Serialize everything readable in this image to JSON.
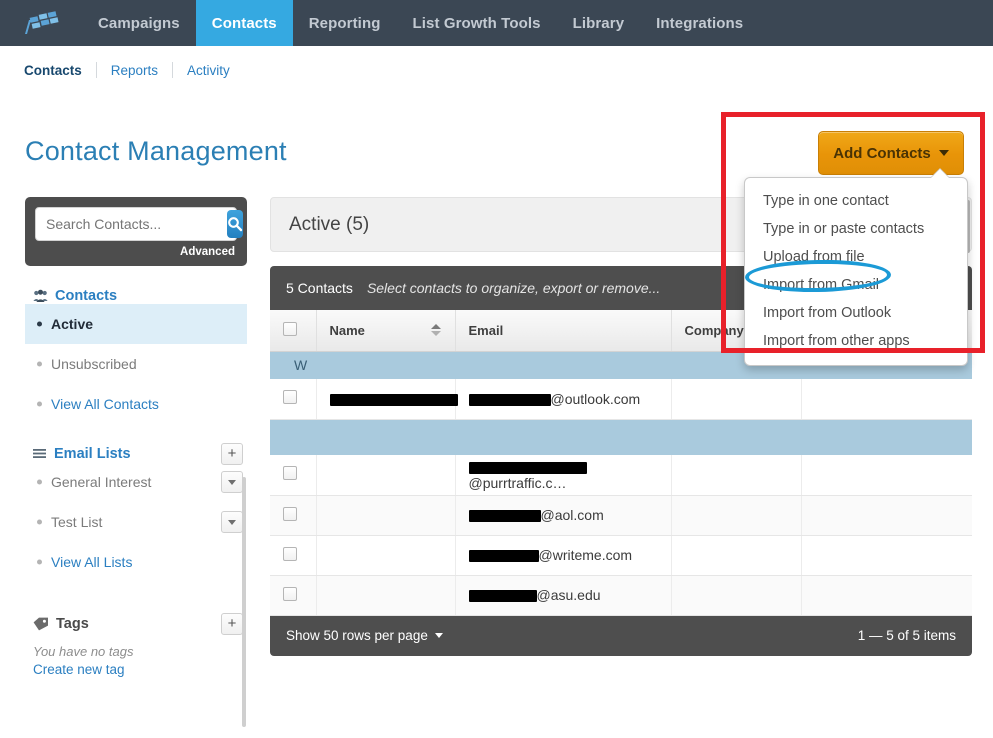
{
  "topnav": {
    "logo": "checkered-flag-logo",
    "items": [
      {
        "label": "Campaigns",
        "active": false
      },
      {
        "label": "Contacts",
        "active": true
      },
      {
        "label": "Reporting",
        "active": false
      },
      {
        "label": "List Growth Tools",
        "active": false
      },
      {
        "label": "Library",
        "active": false
      },
      {
        "label": "Integrations",
        "active": false
      }
    ],
    "active_color": "#35a9e1",
    "bg_color": "#3b4754"
  },
  "subnav": {
    "items": [
      {
        "label": "Contacts",
        "current": true
      },
      {
        "label": "Reports",
        "current": false
      },
      {
        "label": "Activity",
        "current": false
      }
    ]
  },
  "page": {
    "title": "Contact Management",
    "title_color": "#2b7fb4"
  },
  "add_contacts": {
    "label": "Add Contacts",
    "button_color": "#e89408",
    "menu": [
      "Type in one contact",
      "Type in or paste contacts",
      "Upload from file",
      "Import from Gmail",
      "Import from Outlook",
      "Import from other apps"
    ],
    "highlighted_item": "Import from Gmail"
  },
  "annotations": {
    "rectangle_color": "#e8212a",
    "ellipse_color": "#1b9ad6"
  },
  "sidebar": {
    "search": {
      "placeholder": "Search Contacts...",
      "value": "",
      "icon": "search-icon",
      "advanced_label": "Advanced"
    },
    "sections": [
      {
        "icon": "people-icon",
        "label": "Contacts",
        "has_plus": false,
        "items": [
          {
            "label": "Active",
            "selected": true,
            "link": false,
            "chevron": false
          },
          {
            "label": "Unsubscribed",
            "selected": false,
            "link": false,
            "chevron": false
          },
          {
            "label": "View All Contacts",
            "selected": false,
            "link": true,
            "chevron": false
          }
        ]
      },
      {
        "icon": "list-icon",
        "label": "Email Lists",
        "has_plus": true,
        "plus_label": "+",
        "items": [
          {
            "label": "General Interest",
            "selected": false,
            "link": false,
            "chevron": true
          },
          {
            "label": "Test List",
            "selected": false,
            "link": false,
            "chevron": true
          },
          {
            "label": "View All Lists",
            "selected": false,
            "link": true,
            "chevron": false
          }
        ]
      },
      {
        "icon": "tag-icon",
        "label": "Tags",
        "has_plus": true,
        "plus_label": "+",
        "items": []
      }
    ],
    "tags_empty_text": "You have no tags",
    "tags_create_label": "Create new tag"
  },
  "active_panel": {
    "title": "Active (5)"
  },
  "table": {
    "toolbar": {
      "count": "5 Contacts",
      "hint": "Select contacts to organize, export or remove..."
    },
    "columns": [
      "Name",
      "Email",
      "Company",
      ""
    ],
    "sort_column": "Name",
    "group_label": "W",
    "rows": [
      {
        "type": "group",
        "label": "W"
      },
      {
        "type": "data",
        "name_redacted_width": 128,
        "email_redacted_width": 82,
        "email_suffix": "@outlook.com",
        "company": "",
        "extra": "",
        "alt": false
      },
      {
        "type": "group-blank",
        "label": ""
      },
      {
        "type": "data",
        "name_redacted_width": 0,
        "email_redacted_width": 118,
        "email_suffix": "@purrtraffic.c…",
        "company": "",
        "extra": "",
        "alt": false
      },
      {
        "type": "data",
        "name_redacted_width": 0,
        "email_redacted_width": 72,
        "email_suffix": "@aol.com",
        "company": "",
        "extra": "",
        "alt": true
      },
      {
        "type": "data",
        "name_redacted_width": 0,
        "email_redacted_width": 70,
        "email_suffix": "@writeme.com",
        "company": "",
        "extra": "",
        "alt": false
      },
      {
        "type": "data",
        "name_redacted_width": 0,
        "email_redacted_width": 68,
        "email_suffix": "@asu.edu",
        "company": "",
        "extra": "",
        "alt": true
      }
    ],
    "footer": {
      "rows_per_page_label": "Show 50 rows per page",
      "pagination": "1 — 5 of 5 items"
    }
  }
}
